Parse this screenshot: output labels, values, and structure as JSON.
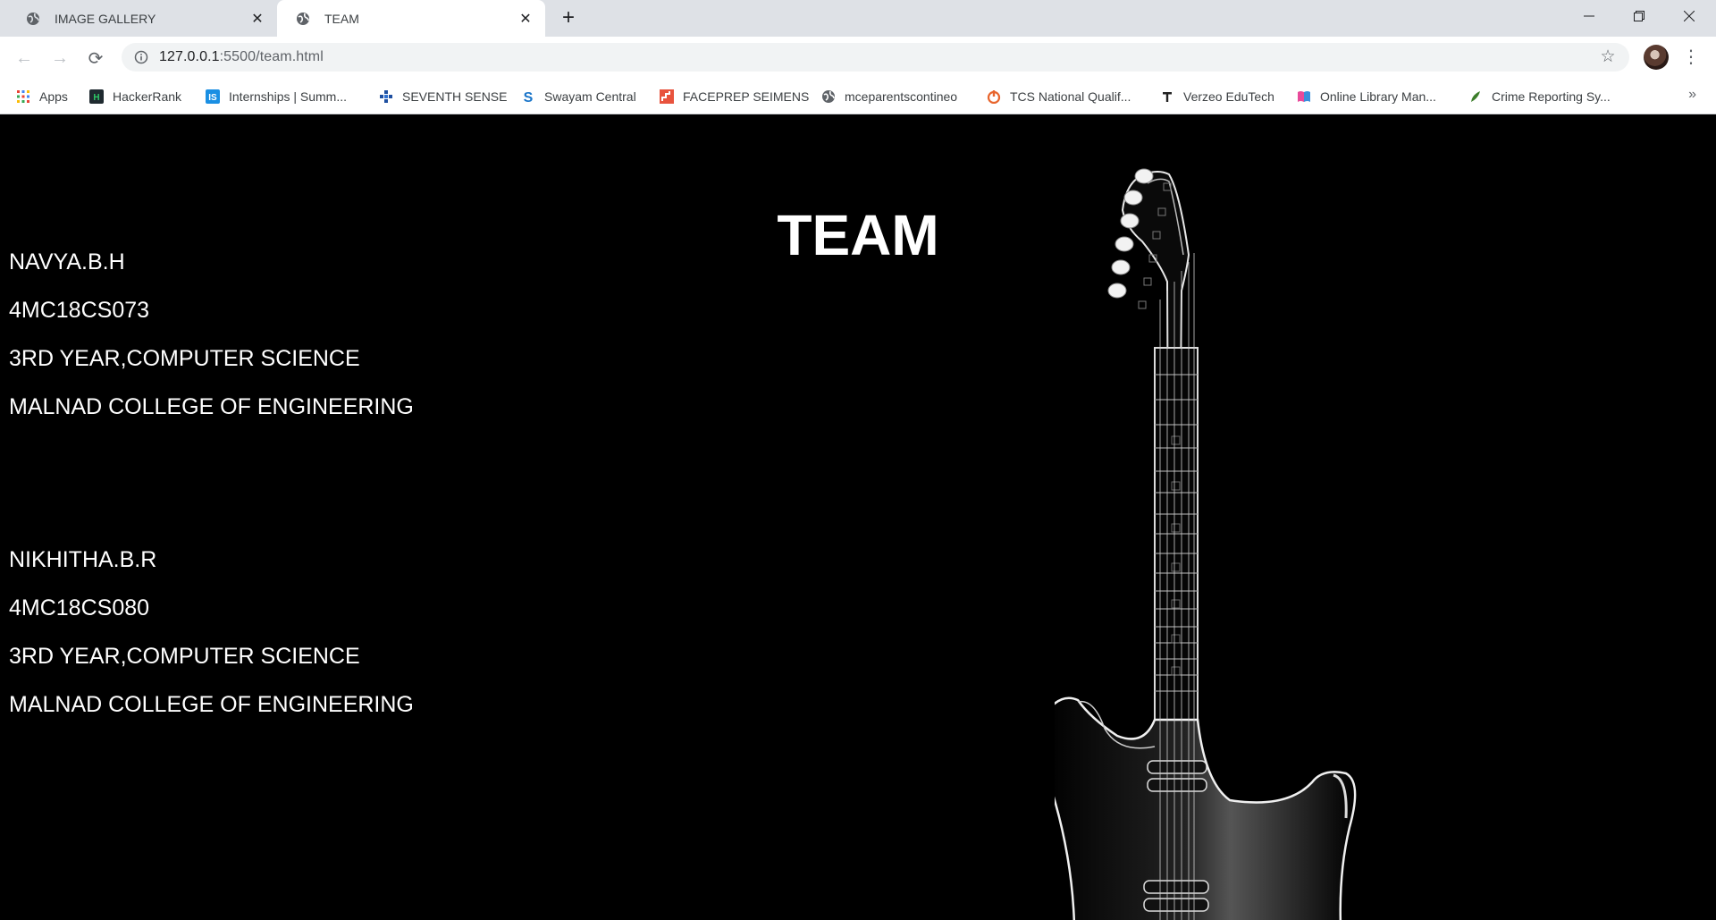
{
  "browser": {
    "tabs": [
      {
        "title": "IMAGE GALLERY",
        "active": false
      },
      {
        "title": "TEAM",
        "active": true
      }
    ],
    "address": {
      "host": "127.0.0.1",
      "path": ":5500/team.html"
    },
    "bookmarks": [
      {
        "label": "Apps",
        "icon": "apps-grid-icon"
      },
      {
        "label": "HackerRank",
        "icon": "hackerrank-icon"
      },
      {
        "label": "Internships | Summ...",
        "icon": "internshala-icon"
      },
      {
        "label": "SEVENTH SENSE",
        "icon": "seventh-sense-icon"
      },
      {
        "label": "Swayam Central",
        "icon": "swayam-icon"
      },
      {
        "label": "FACEPREP SEIMENS",
        "icon": "faceprep-icon"
      },
      {
        "label": "mceparentscontineo",
        "icon": "globe-icon"
      },
      {
        "label": "TCS National Qualif...",
        "icon": "tcs-icon"
      },
      {
        "label": "Verzeo EduTech",
        "icon": "verzeo-icon"
      },
      {
        "label": "Online Library Man...",
        "icon": "library-icon"
      },
      {
        "label": "Crime Reporting Sy...",
        "icon": "leaf-icon"
      }
    ],
    "more_bookmarks": "»"
  },
  "page": {
    "title": "TEAM",
    "members": [
      {
        "name": "NAVYA.B.H",
        "usn": "4MC18CS073",
        "year": "3RD YEAR,COMPUTER SCIENCE",
        "college": "MALNAD COLLEGE OF ENGINEERING"
      },
      {
        "name": "NIKHITHA.B.R",
        "usn": "4MC18CS080",
        "year": "3RD YEAR,COMPUTER SCIENCE",
        "college": "MALNAD COLLEGE OF ENGINEERING"
      }
    ],
    "background_image": "electric-guitar-illustration"
  },
  "colors": {
    "page_bg": "#000000",
    "page_text": "#ffffff",
    "tabstrip": "#dee1e6"
  }
}
